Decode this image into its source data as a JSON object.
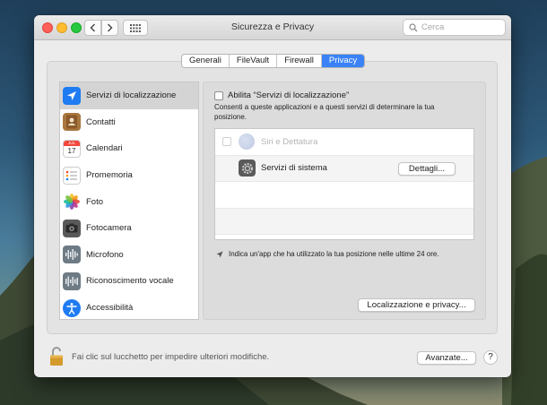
{
  "window": {
    "title": "Sicurezza e Privacy",
    "search_placeholder": "Cerca"
  },
  "tabs": [
    {
      "label": "Generali",
      "active": false
    },
    {
      "label": "FileVault",
      "active": false
    },
    {
      "label": "Firewall",
      "active": false
    },
    {
      "label": "Privacy",
      "active": true
    }
  ],
  "sidebar": {
    "items": [
      {
        "label": "Servizi di localizzazione",
        "icon": "location-arrow-icon",
        "selected": true
      },
      {
        "label": "Contatti",
        "icon": "contacts-book-icon",
        "selected": false
      },
      {
        "label": "Calendari",
        "icon": "calendar-icon",
        "selected": false
      },
      {
        "label": "Promemoria",
        "icon": "reminders-list-icon",
        "selected": false
      },
      {
        "label": "Foto",
        "icon": "photos-flower-icon",
        "selected": false
      },
      {
        "label": "Fotocamera",
        "icon": "camera-icon",
        "selected": false
      },
      {
        "label": "Microfono",
        "icon": "microphone-waveform-icon",
        "selected": false
      },
      {
        "label": "Riconoscimento vocale",
        "icon": "speech-waveform-icon",
        "selected": false
      },
      {
        "label": "Accessibilità",
        "icon": "accessibility-person-icon",
        "selected": false
      }
    ],
    "calendar_month": "JUL",
    "calendar_day": "17"
  },
  "location": {
    "enable_label": "Abilita “Servizi di localizzazione”",
    "enabled": false,
    "description": "Consenti a queste applicazioni e a questi servizi di determinare la tua posizione.",
    "apps": [
      {
        "name": "Siri e Dettatura",
        "icon": "siri-icon",
        "disabled": true
      },
      {
        "name": "Servizi di sistema",
        "icon": "system-gear-icon",
        "disabled": false,
        "button": "Dettagli..."
      }
    ],
    "note": "Indica un'app che ha utilizzato la tua posizione nelle ultime 24 ore.",
    "about_button": "Localizzazione e privacy..."
  },
  "footer": {
    "lock_text": "Fai clic sul lucchetto per impedire ulteriori modifiche.",
    "advanced_button": "Avanzate...",
    "help_label": "?"
  },
  "colors": {
    "accent": "#3a82f6",
    "close": "#fe5f57",
    "minimize": "#febc2e",
    "zoom": "#28c840"
  }
}
